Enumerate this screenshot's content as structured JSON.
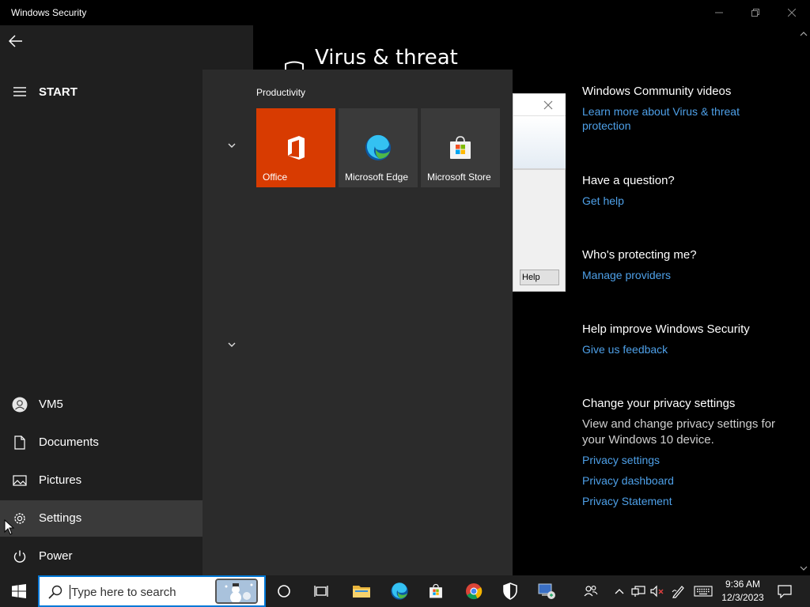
{
  "window": {
    "title": "Windows Security",
    "heading": "Virus & threat"
  },
  "side_panel": {
    "community": {
      "title": "Windows Community videos",
      "link": "Learn more about Virus & threat protection"
    },
    "question": {
      "title": "Have a question?",
      "link": "Get help"
    },
    "protecting": {
      "title": "Who's protecting me?",
      "link": "Manage providers"
    },
    "improve": {
      "title": "Help improve Windows Security",
      "link": "Give us feedback"
    },
    "privacy": {
      "title": "Change your privacy settings",
      "text": "View and change privacy settings for your Windows 10 device.",
      "links": [
        "Privacy settings",
        "Privacy dashboard",
        "Privacy Statement"
      ]
    }
  },
  "dialog": {
    "help_label": "Help"
  },
  "start_menu": {
    "label": "START",
    "rail": [
      {
        "label": "VM5",
        "icon": "user-icon"
      },
      {
        "label": "Documents",
        "icon": "document-icon"
      },
      {
        "label": "Pictures",
        "icon": "pictures-icon"
      },
      {
        "label": "Settings",
        "icon": "gear-icon"
      },
      {
        "label": "Power",
        "icon": "power-icon"
      }
    ],
    "group_title": "Productivity",
    "tiles": [
      {
        "label": "Office",
        "icon": "office-icon"
      },
      {
        "label": "Microsoft Edge",
        "icon": "edge-icon"
      },
      {
        "label": "Microsoft Store",
        "icon": "store-icon"
      }
    ]
  },
  "taskbar": {
    "search_placeholder": "Type here to search",
    "clock": {
      "time": "9:36 AM",
      "date": "12/3/2023"
    }
  },
  "colors": {
    "accent": "#0078d7",
    "link": "#4ea0e8",
    "office_tile": "#d83b01"
  }
}
